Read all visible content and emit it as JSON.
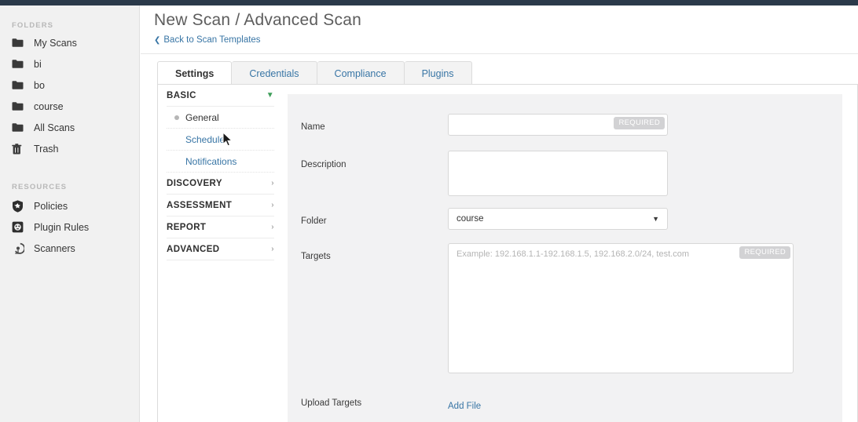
{
  "header": {
    "title": "New Scan / Advanced Scan",
    "back_link": "Back to Scan Templates",
    "back_chevron": "chevron-left-icon"
  },
  "sidebar": {
    "folders_heading": "FOLDERS",
    "resources_heading": "RESOURCES",
    "folders": [
      {
        "label": "My Scans",
        "icon": "folder-icon"
      },
      {
        "label": "bi",
        "icon": "folder-icon"
      },
      {
        "label": "bo",
        "icon": "folder-icon"
      },
      {
        "label": "course",
        "icon": "folder-icon"
      },
      {
        "label": "All Scans",
        "icon": "folder-icon"
      },
      {
        "label": "Trash",
        "icon": "trash-icon"
      }
    ],
    "resources": [
      {
        "label": "Policies",
        "icon": "shield-star-icon"
      },
      {
        "label": "Plugin Rules",
        "icon": "plugin-outlet-icon"
      },
      {
        "label": "Scanners",
        "icon": "radar-dish-icon"
      }
    ]
  },
  "tabs": [
    {
      "label": "Settings",
      "active": true
    },
    {
      "label": "Credentials",
      "active": false
    },
    {
      "label": "Compliance",
      "active": false
    },
    {
      "label": "Plugins",
      "active": false
    }
  ],
  "settings_nav": [
    {
      "label": "BASIC",
      "type": "group",
      "expanded": true,
      "arrow": "chevron-down-icon"
    },
    {
      "label": "General",
      "type": "sub",
      "active": true
    },
    {
      "label": "Schedule",
      "type": "sub",
      "active": false
    },
    {
      "label": "Notifications",
      "type": "sub",
      "active": false
    },
    {
      "label": "DISCOVERY",
      "type": "group",
      "expanded": false,
      "arrow": "chevron-right-icon"
    },
    {
      "label": "ASSESSMENT",
      "type": "group",
      "expanded": false,
      "arrow": "chevron-right-icon"
    },
    {
      "label": "REPORT",
      "type": "group",
      "expanded": false,
      "arrow": "chevron-right-icon"
    },
    {
      "label": "ADVANCED",
      "type": "group",
      "expanded": false,
      "arrow": "chevron-right-icon"
    }
  ],
  "form": {
    "name": {
      "label": "Name",
      "value": "",
      "placeholder": "",
      "required_badge": "REQUIRED"
    },
    "description": {
      "label": "Description",
      "value": "",
      "placeholder": ""
    },
    "folder": {
      "label": "Folder",
      "selected": "course",
      "caret": "chevron-down-icon",
      "options": [
        "course"
      ]
    },
    "targets": {
      "label": "Targets",
      "value": "",
      "placeholder": "Example: 192.168.1.1-192.168.1.5, 192.168.2.0/24, test.com",
      "required_badge": "REQUIRED"
    },
    "upload_targets": {
      "label": "Upload Targets",
      "action_label": "Add File"
    }
  },
  "colors": {
    "topbar": "#2b3a4a",
    "sidebar_bg": "#f1f1f1",
    "link_blue": "#3875a5",
    "panel_bg": "#f2f2f3",
    "expanded_arrow_green": "#3f9e5a",
    "required_badge": "#d2d2d4"
  }
}
